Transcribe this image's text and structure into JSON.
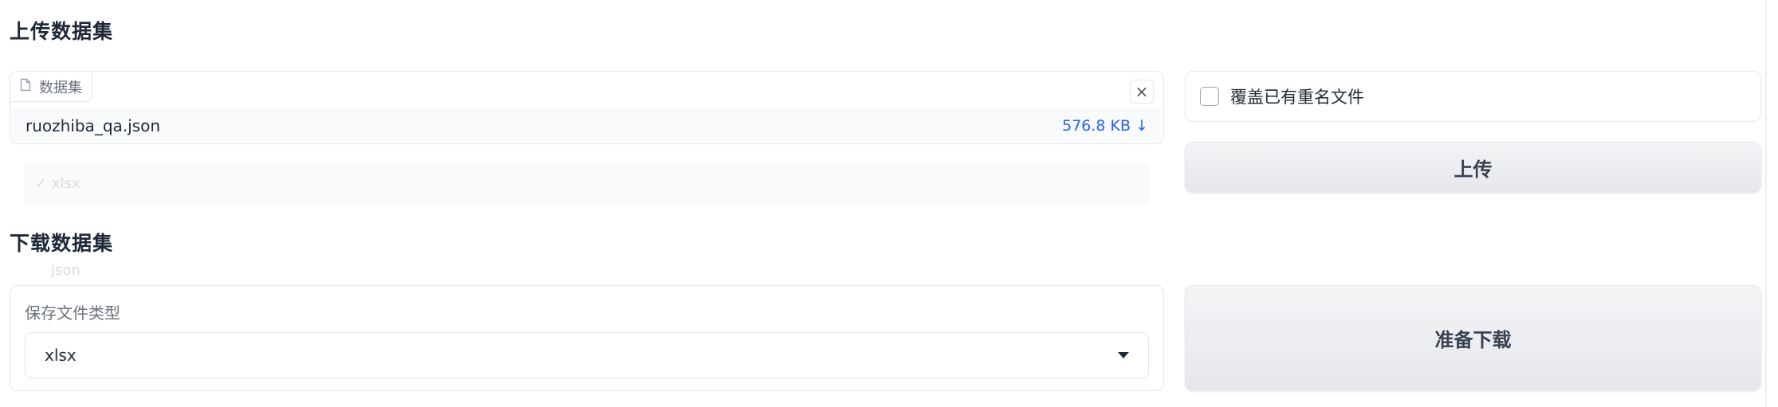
{
  "upload_section": {
    "title": "上传数据集",
    "file_box": {
      "tag_label": "数据集",
      "close_symbol": "×",
      "file_name": "ruozhiba_qa.json",
      "file_size": "576.8 KB ↓"
    },
    "overwrite_checkbox": {
      "label": "覆盖已有重名文件",
      "checked": false
    },
    "upload_button_label": "上传"
  },
  "ghost_options": {
    "selected": "✓ xlsx",
    "other": "json"
  },
  "download_section": {
    "title": "下载数据集",
    "file_type_label": "保存文件类型",
    "file_type_value": "xlsx",
    "prepare_button_label": "准备下载"
  },
  "colors": {
    "accent_link": "#2563eb",
    "button_bg": "#e5e7eb",
    "border": "#e5e7eb"
  }
}
